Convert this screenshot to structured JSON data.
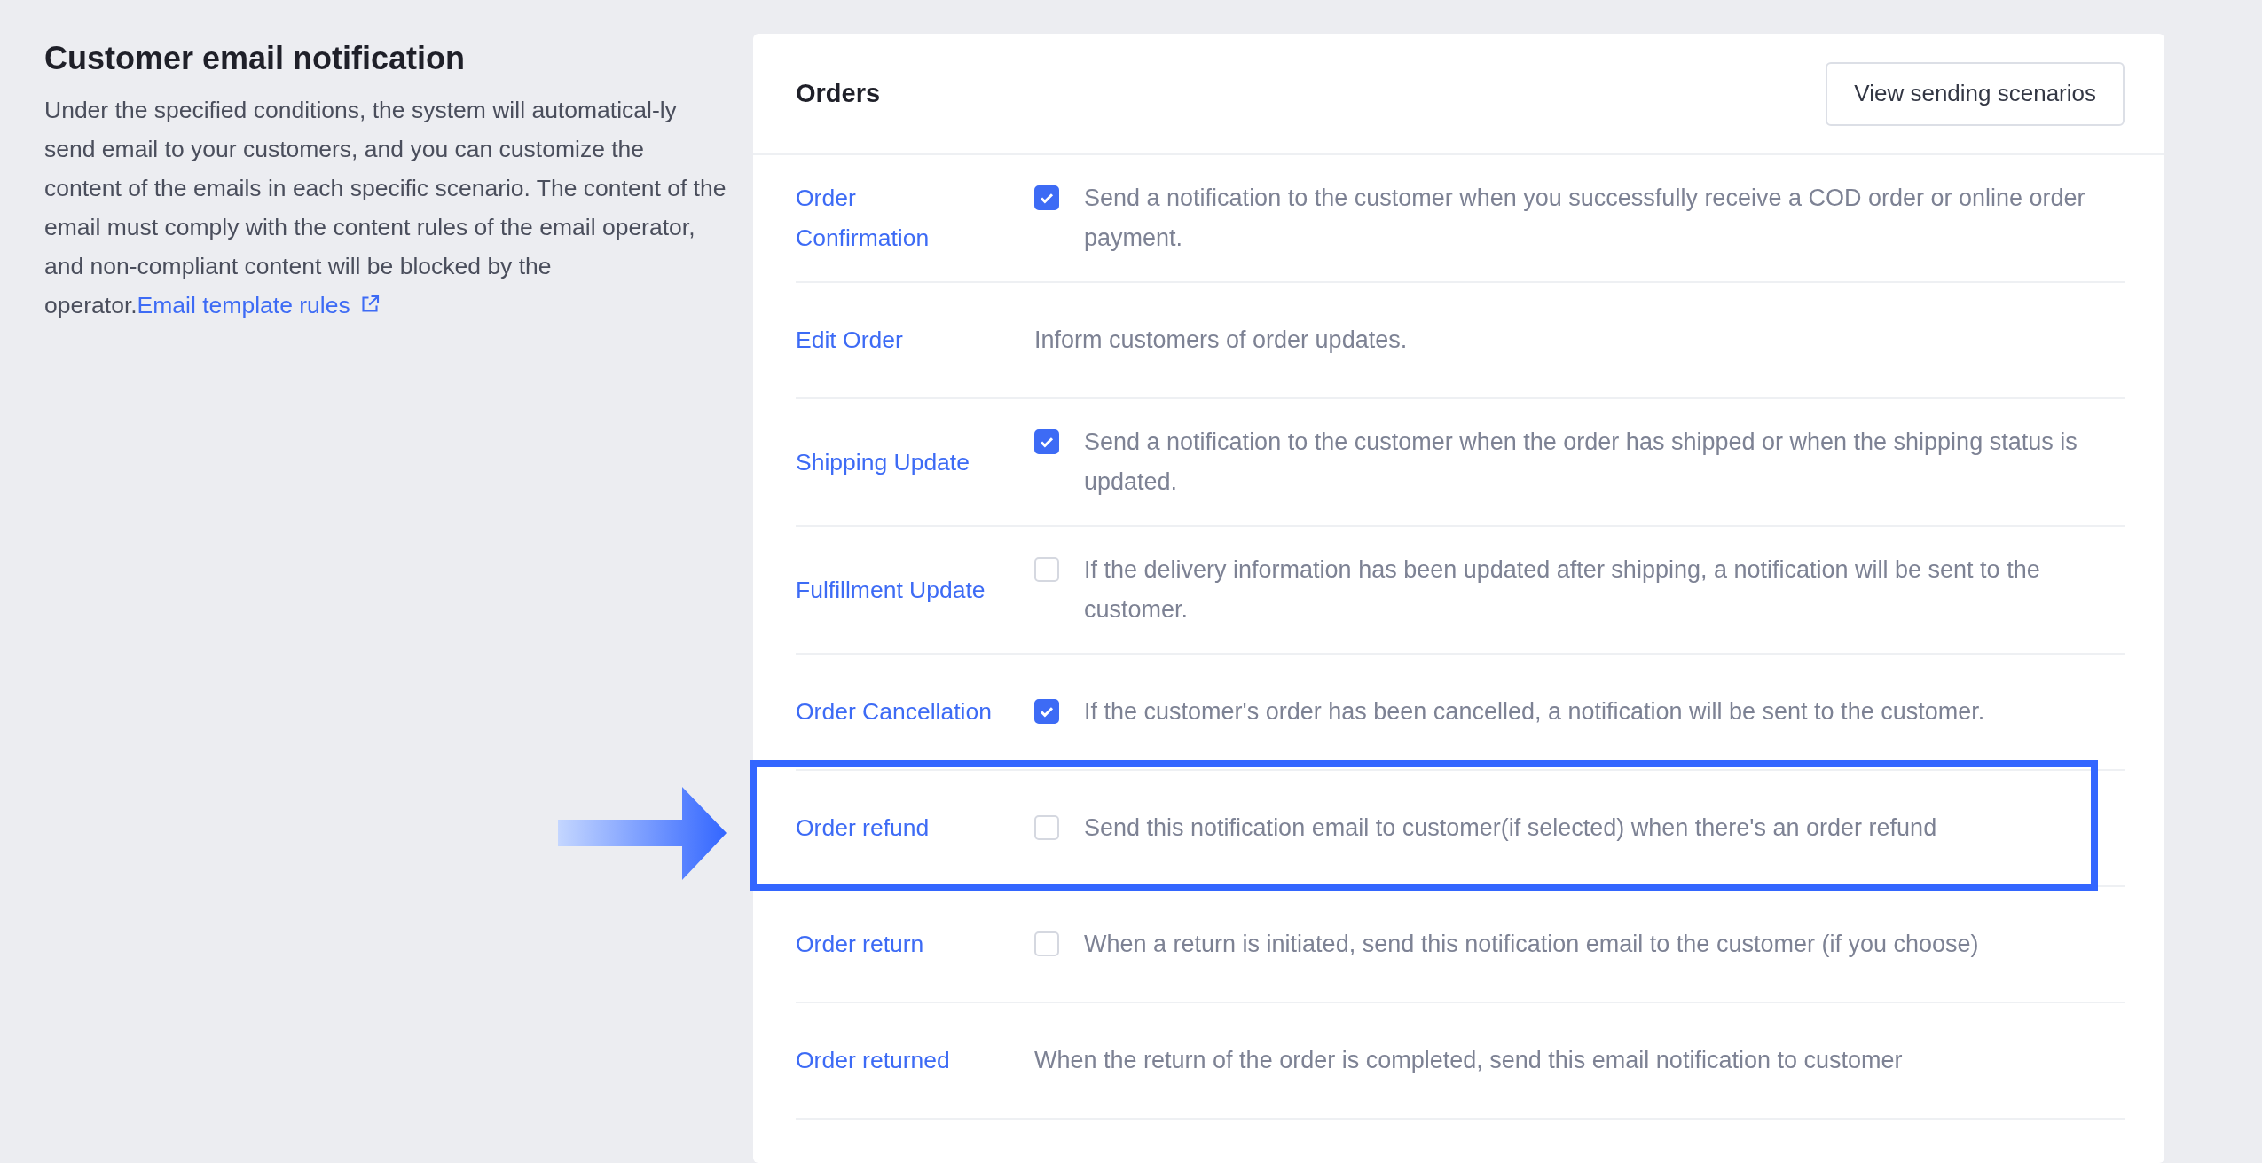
{
  "intro": {
    "title": "Customer email notification",
    "body": "Under the specified conditions, the system will automatical-ly send email to your customers, and you can customize the content of the emails in each specific scenario. The content of the email must comply with the content rules of the email operator, and non-compliant content will be blocked by the operator.",
    "link": "Email template rules"
  },
  "card": {
    "title": "Orders",
    "button": "View sending scenarios",
    "rows": [
      {
        "label": "Order Confirmation",
        "kind": "checkbox",
        "checked": true,
        "highlighted": false,
        "description": "Send a notification to the customer when you successfully receive a COD order or online order payment."
      },
      {
        "label": "Edit Order",
        "kind": "text",
        "highlighted": false,
        "description": "Inform customers of order updates."
      },
      {
        "label": "Shipping Update",
        "kind": "checkbox",
        "checked": true,
        "highlighted": false,
        "description": "Send a notification to the customer when the order has shipped or when the shipping status is updated."
      },
      {
        "label": "Fulfillment Update",
        "kind": "checkbox",
        "checked": false,
        "highlighted": false,
        "description": "If the delivery information has been updated after shipping, a notification will be sent to the customer."
      },
      {
        "label": "Order Cancellation",
        "kind": "checkbox",
        "checked": true,
        "highlighted": false,
        "description": "If the customer's order has been cancelled, a notification will be sent to the customer."
      },
      {
        "label": "Order refund",
        "kind": "checkbox",
        "checked": false,
        "highlighted": true,
        "description": "Send this notification email to customer(if selected) when there's an order refund"
      },
      {
        "label": "Order return",
        "kind": "checkbox",
        "checked": false,
        "highlighted": false,
        "description": "When a return is initiated, send this notification email to the customer (if you choose)"
      },
      {
        "label": "Order returned",
        "kind": "text",
        "highlighted": false,
        "description": "When the return of the order is completed, send this email notification to customer"
      }
    ]
  }
}
